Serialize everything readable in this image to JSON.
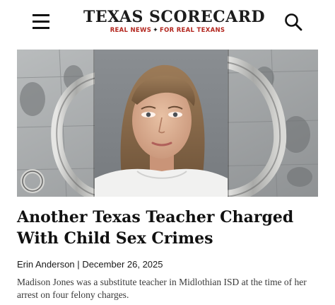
{
  "header": {
    "logo_title": "TEXAS SCORECARD",
    "tagline_left": "REAL NEWS",
    "tagline_right": "FOR REAL TEXANS",
    "tagline_icon": "texas-state-icon",
    "menu_icon": "hamburger-menu-icon",
    "search_icon": "search-icon",
    "accent_color": "#b3261e"
  },
  "hero": {
    "image": "mugshot-over-handcuffs-and-fingerprints"
  },
  "article": {
    "headline": "Another Texas Teacher Charged With Child Sex Crimes",
    "author": "Erin Anderson",
    "separator": "|",
    "date": "December 26, 2025",
    "excerpt": "Madison Jones was a substitute teacher in Midlothian ISD at the time of her arrest on four felony charges."
  }
}
